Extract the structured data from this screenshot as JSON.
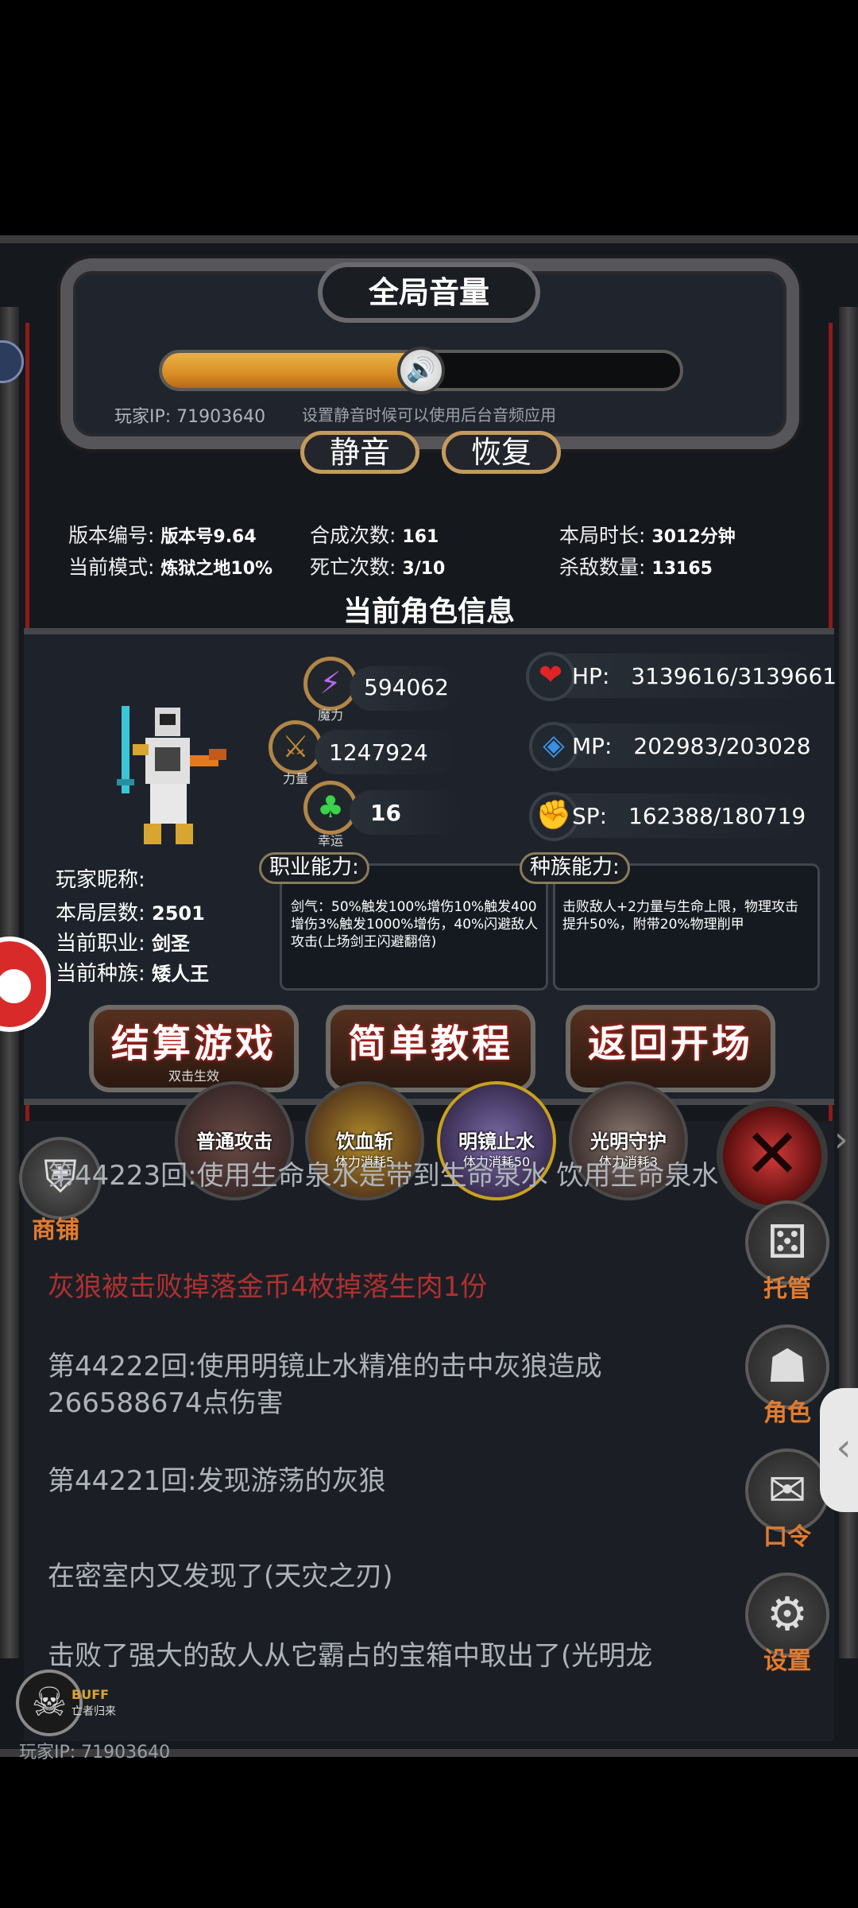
{
  "volume": {
    "title": "全局音量",
    "level_percent": 50,
    "knob_icon": "speaker-icon",
    "player_ip_label": "玩家IP:  71903640",
    "hint": "设置静音时候可以使用后台音频应用",
    "mute_label": "静音",
    "restore_label": "恢复"
  },
  "info": {
    "version_label": "版本编号:",
    "version_value": "版本号9.64",
    "mode_label": "当前模式:",
    "mode_value": "炼狱之地10%",
    "synth_label": "合成次数:",
    "synth_value": "161",
    "death_label": "死亡次数:",
    "death_value": "3/10",
    "time_label": "本局时长:",
    "time_value": "3012分钟",
    "kill_label": "杀敌数量:",
    "kill_value": "13165"
  },
  "role": {
    "title": "当前角色信息",
    "magic_label": "魔力",
    "magic_value": "594062",
    "power_label": "力量",
    "power_value": "1247924",
    "luck_label": "幸运",
    "luck_value": "16",
    "hp_label": "HP:",
    "hp_value": "3139616/3139661",
    "mp_label": "MP:",
    "mp_value": "202983/203028",
    "sp_label": "SP:",
    "sp_value": "162388/180719",
    "nickname_label": "玩家昵称:",
    "floor_label": "本局层数:",
    "floor_value": "2501",
    "job_label": "当前职业:",
    "job_value": "剑圣",
    "race_label": "当前种族:",
    "race_value": "矮人王",
    "job_ability_tag": "职业能力:",
    "job_ability_text": "剑气：50%触发100%增伤10%触发400增伤3%触发1000%增伤，40%闪避敌人攻击(上场剑王闪避翻倍)",
    "race_ability_tag": "种族能力:",
    "race_ability_text": "击败敌人+2力量与生命上限，物理攻击提升50%，附带20%物理削甲"
  },
  "buttons": {
    "settle_label": "结算游戏",
    "settle_sub": "双击生效",
    "tutorial_label": "简单教程",
    "return_label": "返回开场"
  },
  "skills": [
    {
      "name": "普通攻击",
      "cost": ""
    },
    {
      "name": "饮血斩",
      "cost": "体力消耗5"
    },
    {
      "name": "明镜止水",
      "cost": "体力消耗50"
    },
    {
      "name": "光明守护",
      "cost": "体力消耗3"
    }
  ],
  "shop_label": "商铺",
  "log": [
    "第44223回:使用生命泉水是带到生命泉水 饮用生命泉水",
    "灰狼被击败掉落金币4枚掉落生肉1份",
    "第44222回:使用明镜止水精准的击中灰狼造成266588674点伤害",
    "第44221回:发现游荡的灰狼",
    "在密室内又发现了(天灾之刃)",
    "击败了强大的敌人从它霸占的宝箱中取出了(光明龙"
  ],
  "side": {
    "auto_label": "托管",
    "role_label": "角色",
    "code_label": "口令",
    "settings_label": "设置"
  },
  "buff": {
    "label": "BUFF",
    "sub": "亡者归来"
  },
  "footer_ip": "玩家IP:  71903640",
  "colors": {
    "accent": "#e37b2f",
    "volume_fill": "#d98e24",
    "log_red": "#b03030"
  }
}
